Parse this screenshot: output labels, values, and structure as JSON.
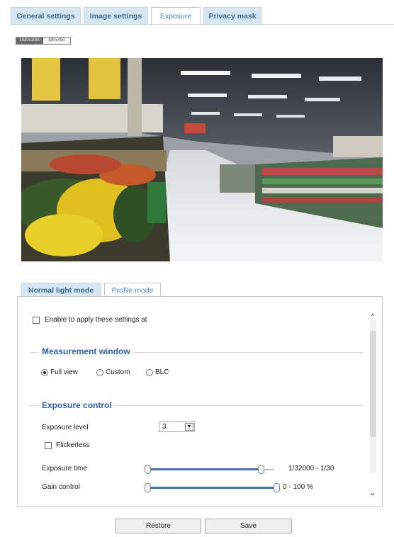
{
  "top_tabs": [
    {
      "label": "General settings",
      "active": false
    },
    {
      "label": "Image settings",
      "active": false
    },
    {
      "label": "Exposure",
      "active": true
    },
    {
      "label": "Privacy mask",
      "active": false
    }
  ],
  "stream_toggle": {
    "left": "1920x1080",
    "right": "800x450"
  },
  "sub_tabs": [
    {
      "label": "Normal light mode",
      "active": true
    },
    {
      "label": "Profile mode",
      "active": false
    }
  ],
  "panel": {
    "enable_label": "Enable to apply these settings at",
    "measurement": {
      "title": "Measurement window",
      "options": [
        {
          "label": "Full view",
          "selected": true
        },
        {
          "label": "Custom",
          "selected": false
        },
        {
          "label": "BLC",
          "selected": false
        }
      ]
    },
    "exposure_control": {
      "title": "Exposure control",
      "level_label": "Exposure level",
      "level_value": "3",
      "flickerless_label": "Flickerless",
      "time_label": "Exposure time",
      "time_range": "1/32000 - 1/30",
      "gain_label": "Gain control",
      "gain_range": "0 - 100 %"
    }
  },
  "buttons": {
    "restore": "Restore",
    "save": "Save"
  },
  "colors": {
    "accent": "#3060a8",
    "tab_bg": "#d6e6f2",
    "slider": "#3b73b0"
  }
}
